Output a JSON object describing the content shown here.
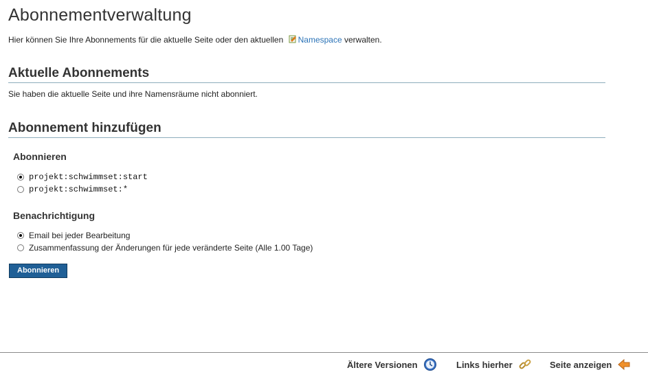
{
  "page": {
    "title": "Abonnementverwaltung",
    "intro_before": "Hier können Sie Ihre Abonnements für die aktuelle Seite oder den aktuellen",
    "intro_link": "Namespace",
    "intro_after": "verwalten."
  },
  "current": {
    "heading": "Aktuelle Abonnements",
    "text": "Sie haben die aktuelle Seite und ihre Namensräume nicht abonniert."
  },
  "add": {
    "heading": "Abonnement hinzufügen",
    "subscribe_heading": "Abonnieren",
    "subscribe_options": [
      "projekt:schwimmset:start",
      "projekt:schwimmset:*"
    ],
    "subscribe_selected": 0,
    "notify_heading": "Benachrichtigung",
    "notify_options": [
      "Email bei jeder Bearbeitung",
      "Zusammenfassung der Änderungen für jede veränderte Seite (Alle 1.00 Tage)"
    ],
    "notify_selected": 0,
    "button": "Abonnieren"
  },
  "footer": {
    "older_versions": "Ältere Versionen",
    "links_here": "Links hierher",
    "show_page": "Seite anzeigen"
  },
  "colors": {
    "link": "#2b73b7",
    "button_bg": "#1f5f96",
    "rule": "#8cacbb"
  }
}
